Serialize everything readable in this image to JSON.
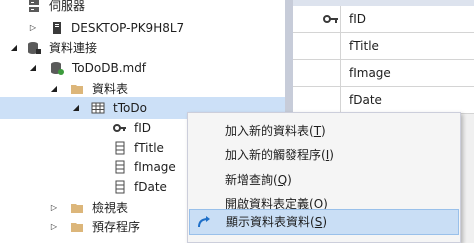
{
  "tree": {
    "server_label": "伺服器",
    "desktop_label": "DESKTOP-PK9H8L7",
    "connections_label": "資料連接",
    "db_label": "ToDoDB.mdf",
    "tables_label": "資料表",
    "table_label": "tToDo",
    "columns": [
      "fID",
      "fTitle",
      "fImage",
      "fDate"
    ],
    "views_label": "檢視表",
    "procs_label": "預存程序"
  },
  "grid": {
    "rows": [
      "fID",
      "fTitle",
      "fImage",
      "fDate"
    ]
  },
  "menu": {
    "items": [
      {
        "text": "加入新的資料表(",
        "key": "T",
        "end": ")"
      },
      {
        "text": "加入新的觸發程序(",
        "key": "I",
        "end": ")"
      },
      {
        "text": "新增查詢(",
        "key": "Q",
        "end": ")"
      },
      {
        "text": "開啟資料表定義(",
        "key": "O",
        "end": ")"
      },
      {
        "text": "顯示資料表資料(",
        "key": "S",
        "end": ")"
      }
    ]
  },
  "colors": {
    "selection": "#cce0f7",
    "menu_highlight": "#c9def5",
    "folder": "#dcb67a",
    "accent": "#1e6fc8"
  }
}
